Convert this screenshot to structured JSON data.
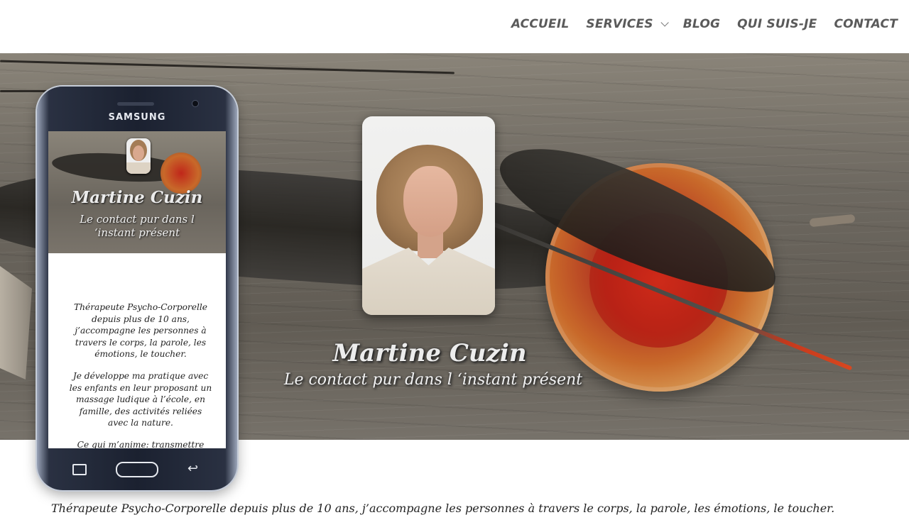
{
  "nav": {
    "items": [
      {
        "label": "ACCUEIL"
      },
      {
        "label": "SERVICES",
        "has_dropdown": true
      },
      {
        "label": "BLOG"
      },
      {
        "label": "QUI SUIS-JE"
      },
      {
        "label": "CONTACT"
      }
    ]
  },
  "hero": {
    "name": "Martine Cuzin",
    "tagline": "Le contact pur dans l ‘instant présent"
  },
  "phone": {
    "brand": "SAMSUNG",
    "name": "Martine Cuzin",
    "tagline": "Le contact pur dans l ‘instant présent",
    "paragraphs": [
      "Thérapeute Psycho-Corporelle depuis plus de 10 ans, j’accompagne les personnes à travers le corps, la parole, les émotions, le toucher.",
      "Je développe ma pratique avec les enfants en leur proposant un massage ludique à l’école, en famille, des activités reliées avec la nature.",
      "Ce qui m’anime: transmettre"
    ]
  },
  "body": {
    "intro": "Thérapeute Psycho-Corporelle depuis plus de 10 ans, j’accompagne les personnes à travers le corps, la parole, les émotions, le toucher."
  }
}
